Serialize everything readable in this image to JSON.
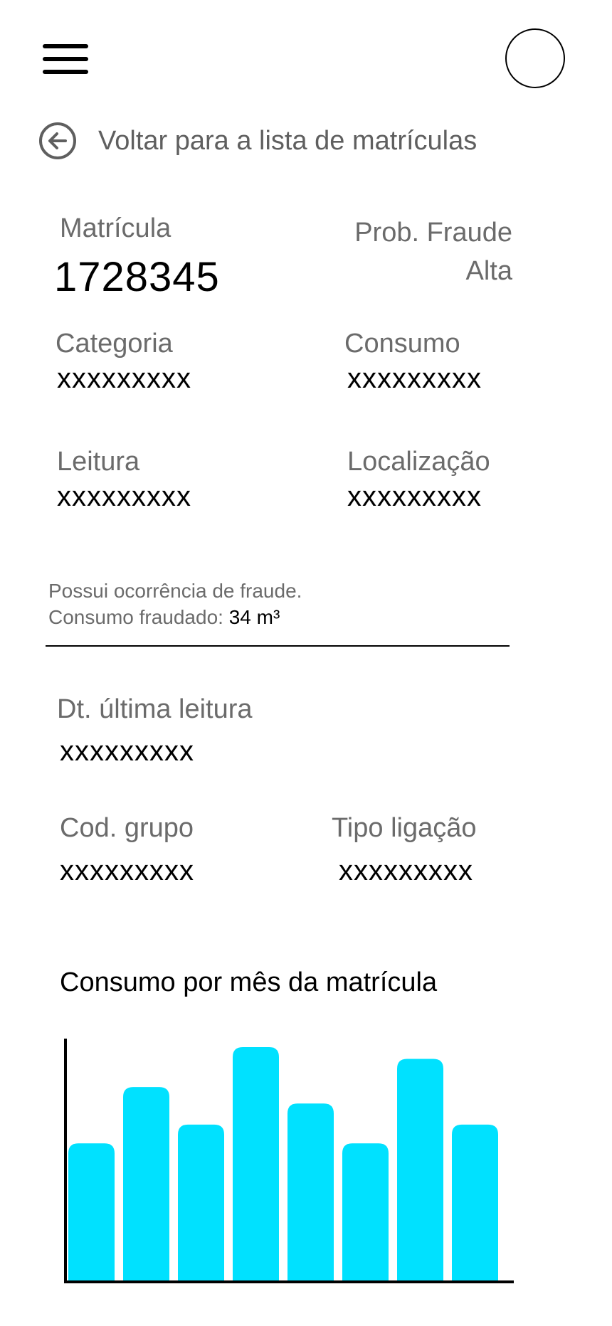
{
  "header": {
    "menu_icon": "hamburger-icon",
    "avatar": "avatar"
  },
  "back": {
    "icon": "arrow-left-circle-icon",
    "label": "Voltar para a lista de matrículas"
  },
  "details": {
    "matricula": {
      "label": "Matrícula",
      "value": "1728345"
    },
    "prob_fraude": {
      "label": "Prob. Fraude",
      "value": "Alta"
    },
    "categoria": {
      "label": "Categoria",
      "value": "xxxxxxxxx"
    },
    "consumo": {
      "label": "Consumo",
      "value": "xxxxxxxxx"
    },
    "leitura": {
      "label": "Leitura",
      "value": "xxxxxxxxx"
    },
    "localizacao": {
      "label": "Localização",
      "value": "xxxxxxxxx"
    }
  },
  "fraud_note": {
    "line1": "Possui ocorrência de fraude.",
    "line2_label": "Consumo fraudado: ",
    "line2_value": "34 m³"
  },
  "reading": {
    "dt_ultima_leitura": {
      "label": "Dt. última leitura",
      "value": "xxxxxxxxx"
    },
    "cod_grupo": {
      "label": "Cod. grupo",
      "value": "xxxxxxxxx"
    },
    "tipo_ligacao": {
      "label": "Tipo ligação",
      "value": "xxxxxxxxx"
    }
  },
  "chart_title": "Consumo por mês da matrícula",
  "chart_data": {
    "type": "bar",
    "values": [
      59,
      83,
      67,
      100,
      76,
      59,
      95,
      67
    ],
    "ylim": [
      0,
      100
    ],
    "bar_color": "#00e1ff",
    "axis_color": "#000000",
    "grid": false
  }
}
